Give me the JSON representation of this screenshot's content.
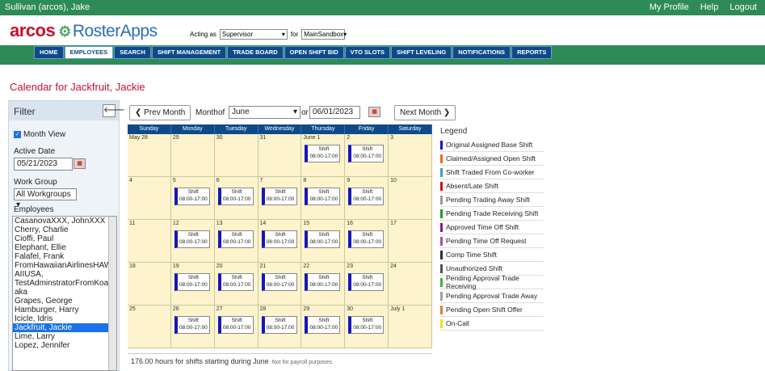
{
  "topbar": {
    "user": "Sullivan (arcos), Jake",
    "links": [
      "My Profile",
      "Help",
      "Logout"
    ]
  },
  "header": {
    "logo_a": "arcos",
    "logo_b": "RosterApps",
    "acting_label": "Acting as",
    "acting_value": "Supervisor",
    "for_label": "for",
    "for_value": "MainSandbox"
  },
  "tabs": [
    "HOME",
    "EMPLOYEES",
    "SEARCH",
    "SHIFT MANAGEMENT",
    "TRADE BOARD",
    "OPEN SHIFT BID",
    "VTO SLOTS",
    "SHIFT LEVELING",
    "NOTIFICATIONS",
    "REPORTS"
  ],
  "page_title": "Calendar for Jackfruit, Jackie",
  "filter": {
    "title": "Filter",
    "month_view": "Month View",
    "active_date_label": "Active Date",
    "active_date": "05/21/2023",
    "work_group_label": "Work Group",
    "work_group": "All Workgroups",
    "employees_label": "Employees",
    "employees": [
      "CasanovaXXX, JohnXXX",
      "Cherry, Charlie",
      "Cioffi, Paul",
      "Elephant, Ellie",
      "Falafel, Frank",
      "FromHawaiianAirlinesHAW",
      "AIIUSA,",
      "TestAdminstratorFromKoap",
      "aka",
      "Grapes, George",
      "Hamburger, Harry",
      "Icicle, Idris",
      "Jackfruit, Jackie",
      "Lime, Larry",
      "Lopez, Jennifer"
    ],
    "selected_employee": "Jackfruit, Jackie"
  },
  "nav": {
    "prev": "❮ Prev Month",
    "month_label": "Month",
    "of_label": "of",
    "month_value": "June",
    "or_label": "or",
    "date_value": "06/01/2023",
    "next": "Next Month ❯"
  },
  "calendar": {
    "days": [
      "Sunday",
      "Monday",
      "Tuesday",
      "Wednesday",
      "Thursday",
      "Friday",
      "Saturday"
    ],
    "shift_label": "Shift",
    "shift_time": "08:00-17:00",
    "weeks": [
      [
        {
          "d": "May 28",
          "s": false
        },
        {
          "d": "29",
          "s": false
        },
        {
          "d": "30",
          "s": false
        },
        {
          "d": "31",
          "s": false
        },
        {
          "d": "June 1",
          "s": true
        },
        {
          "d": "2",
          "s": true
        },
        {
          "d": "3",
          "s": false
        }
      ],
      [
        {
          "d": "4",
          "s": false
        },
        {
          "d": "5",
          "s": true
        },
        {
          "d": "6",
          "s": true
        },
        {
          "d": "7",
          "s": true
        },
        {
          "d": "8",
          "s": true
        },
        {
          "d": "9",
          "s": true
        },
        {
          "d": "10",
          "s": false
        }
      ],
      [
        {
          "d": "11",
          "s": false
        },
        {
          "d": "12",
          "s": true
        },
        {
          "d": "13",
          "s": true
        },
        {
          "d": "14",
          "s": true
        },
        {
          "d": "15",
          "s": true
        },
        {
          "d": "16",
          "s": true
        },
        {
          "d": "17",
          "s": false
        }
      ],
      [
        {
          "d": "18",
          "s": false
        },
        {
          "d": "19",
          "s": true
        },
        {
          "d": "20",
          "s": true
        },
        {
          "d": "21",
          "s": true
        },
        {
          "d": "22",
          "s": true
        },
        {
          "d": "23",
          "s": true
        },
        {
          "d": "24",
          "s": false
        }
      ],
      [
        {
          "d": "25",
          "s": false
        },
        {
          "d": "26",
          "s": true
        },
        {
          "d": "27",
          "s": true
        },
        {
          "d": "28",
          "s": true
        },
        {
          "d": "29",
          "s": true
        },
        {
          "d": "30",
          "s": true
        },
        {
          "d": "July 1",
          "s": false
        }
      ]
    ],
    "hours_note": "176.00 hours for shifts starting during June",
    "payroll_note": "Not for payroll purposes"
  },
  "legend": {
    "title": "Legend",
    "items": [
      {
        "label": "Original Assigned Base Shift",
        "color": "#1515c0"
      },
      {
        "label": "Claimed/Assigned Open Shift",
        "color": "#e07020"
      },
      {
        "label": "Shift Traded From Co-worker",
        "color": "#3aa0c8"
      },
      {
        "label": "Absent/Late Shift",
        "color": "#d01010"
      },
      {
        "label": "Pending Trading Away Shift",
        "color": "#9a9a9a"
      },
      {
        "label": "Pending Trade Receiving Shift",
        "color": "#20a020"
      },
      {
        "label": "Approved Time Off Shift",
        "color": "#8a1a8a"
      },
      {
        "label": "Pending Time Off Request",
        "color": "#b04ab0"
      },
      {
        "label": "Comp Time Shift",
        "color": "#303030"
      },
      {
        "label": "Unauthorized Shift",
        "color": "#505050"
      },
      {
        "label": "Pending Approval Trade Receiving",
        "color": "#40b040"
      },
      {
        "label": "Pending Approval Trade Away",
        "color": "#a0a0a0"
      },
      {
        "label": "Pending Open Shift Offer",
        "color": "#e08030"
      },
      {
        "label": "On-Call",
        "color": "#f0e020"
      }
    ]
  }
}
